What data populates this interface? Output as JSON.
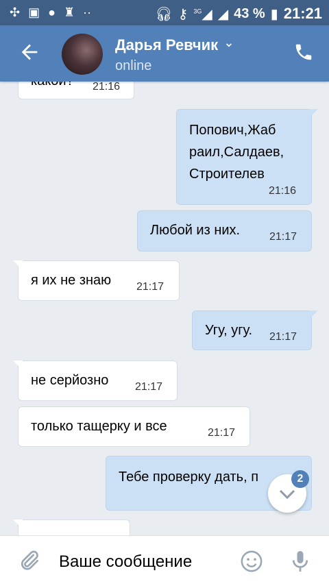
{
  "status_bar": {
    "battery": "43 %",
    "time": "21:21",
    "network": "3G"
  },
  "header": {
    "contact_name": "Дарья Ревчик",
    "status": "online"
  },
  "messages": [
    {
      "dir": "in",
      "text": "какой?",
      "time": "21:16"
    },
    {
      "dir": "out",
      "text_lines": [
        "Попович,Жаб",
        "раил,Салдаев,",
        "Строителев"
      ],
      "time": "21:16"
    },
    {
      "dir": "out",
      "text": "Любой из них.",
      "time": "21:17"
    },
    {
      "dir": "in",
      "text": "я их не знаю",
      "time": "21:17"
    },
    {
      "dir": "out",
      "text": "Угу, угу.",
      "time": "21:17"
    },
    {
      "dir": "in",
      "text": "не серйозно",
      "time": "21:17"
    },
    {
      "dir": "in",
      "text": "только тащерку и все",
      "time": "21:17"
    },
    {
      "dir": "out",
      "text": "Тебе проверку дать, п",
      "time": ""
    }
  ],
  "scroll_down": {
    "unread_count": "2"
  },
  "input": {
    "placeholder": "Ваше сообщение"
  },
  "colors": {
    "header": "#5181b8",
    "status_bar": "#3f5f86",
    "outgoing": "#cce0f5",
    "incoming": "#ffffff",
    "background": "#e9edf1"
  }
}
